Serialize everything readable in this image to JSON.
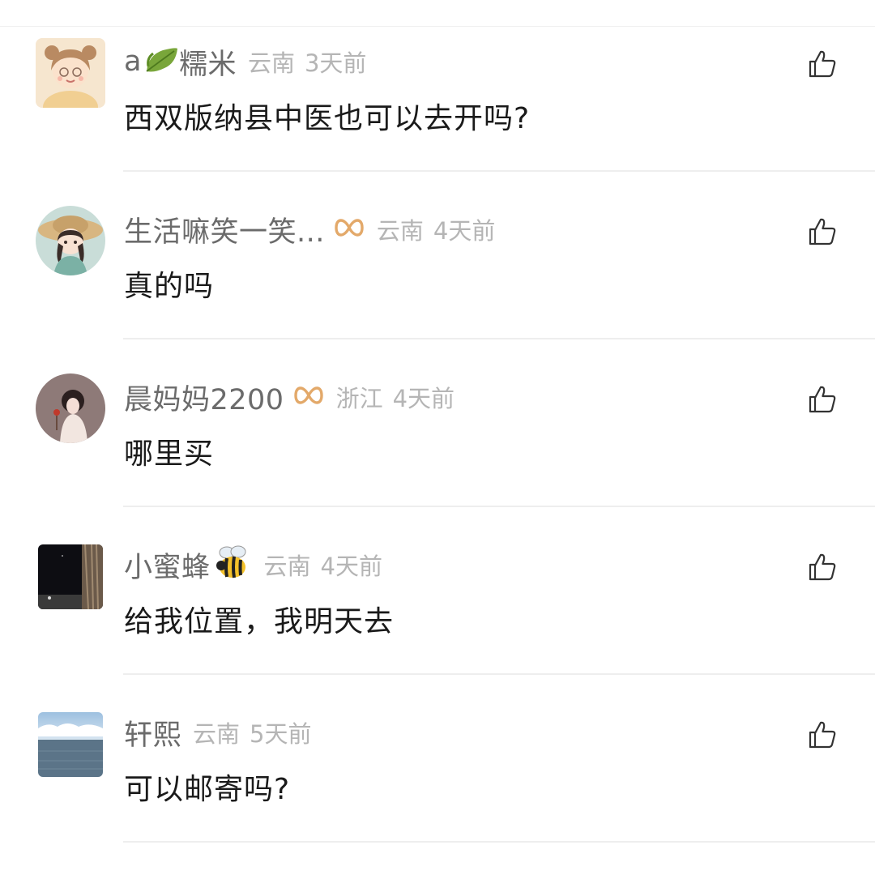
{
  "comments": [
    {
      "username": "a",
      "username_suffix": "糯米",
      "location": "云南",
      "time": "3天前",
      "text": "西双版纳县中医也可以去开吗?",
      "name_emoji": "leaf-icon"
    },
    {
      "username": "生活嘛笑一笑...",
      "location": "云南",
      "time": "4天前",
      "text": "真的吗",
      "badge": "infinity-badge-icon"
    },
    {
      "username": "晨妈妈2200",
      "location": "浙江",
      "time": "4天前",
      "text": "哪里买",
      "badge": "infinity-badge-icon"
    },
    {
      "username": "小蜜蜂",
      "location": "云南",
      "time": "4天前",
      "text": "给我位置，我明天去",
      "name_emoji": "bee-icon"
    },
    {
      "username": "轩熙",
      "location": "云南",
      "time": "5天前",
      "text": "可以邮寄吗?"
    }
  ],
  "colors": {
    "username": "#6b6b6b",
    "meta": "#b5b5b5",
    "content": "#1a1a1a",
    "badge": "#e3a96a",
    "divider": "#eeeeee"
  },
  "icons": {
    "like": "thumbs-up-icon"
  }
}
